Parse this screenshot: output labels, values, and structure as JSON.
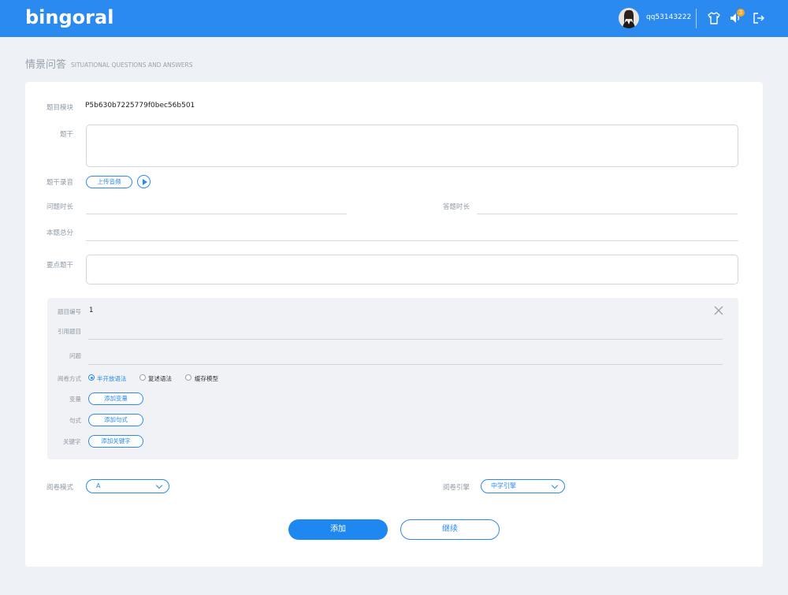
{
  "header": {
    "logo": "bingoral",
    "username": "qq53143222",
    "notification_count": "3",
    "icons": [
      "shirt-icon",
      "speaker-icon",
      "logout-icon"
    ]
  },
  "page": {
    "title": "情景问答",
    "subtitle": "SITUATIONAL QUESTIONS AND ANSWERS"
  },
  "form": {
    "module_label": "题目模块",
    "module_value": "P5b630b7225779f0bec56b501",
    "stem_label": "题干",
    "stem_value": "",
    "stem_audio_label": "题干录音",
    "upload_audio_label": "上传音频",
    "question_duration_label": "问题时长",
    "answer_duration_label": "答题时长",
    "total_score_label": "本题总分",
    "key_stem_label": "要点题干"
  },
  "subquestion": {
    "number_label": "题目编号",
    "number_value": "1",
    "reference_label": "引用题目",
    "question_label": "问题",
    "grading_label": "阅卷方式",
    "grading_options": [
      "半开放语法",
      "复述语法",
      "缓存模型"
    ],
    "grading_selected": "半开放语法",
    "variable_label": "变量",
    "add_variable": "添加变量",
    "sentence_label": "句式",
    "add_sentence": "添加句式",
    "keyword_label": "关键字",
    "add_keyword": "添加关键字"
  },
  "grading": {
    "mode_label": "阅卷模式",
    "mode_value": "A",
    "engine_label": "阅卷引擎",
    "engine_value": "中学引擎"
  },
  "actions": {
    "add": "添加",
    "continue": "继续"
  },
  "colors": {
    "header": "#2b8af0",
    "accent": "#2b8af0",
    "background": "#eef2f6",
    "panel": "#f0f2f5"
  }
}
